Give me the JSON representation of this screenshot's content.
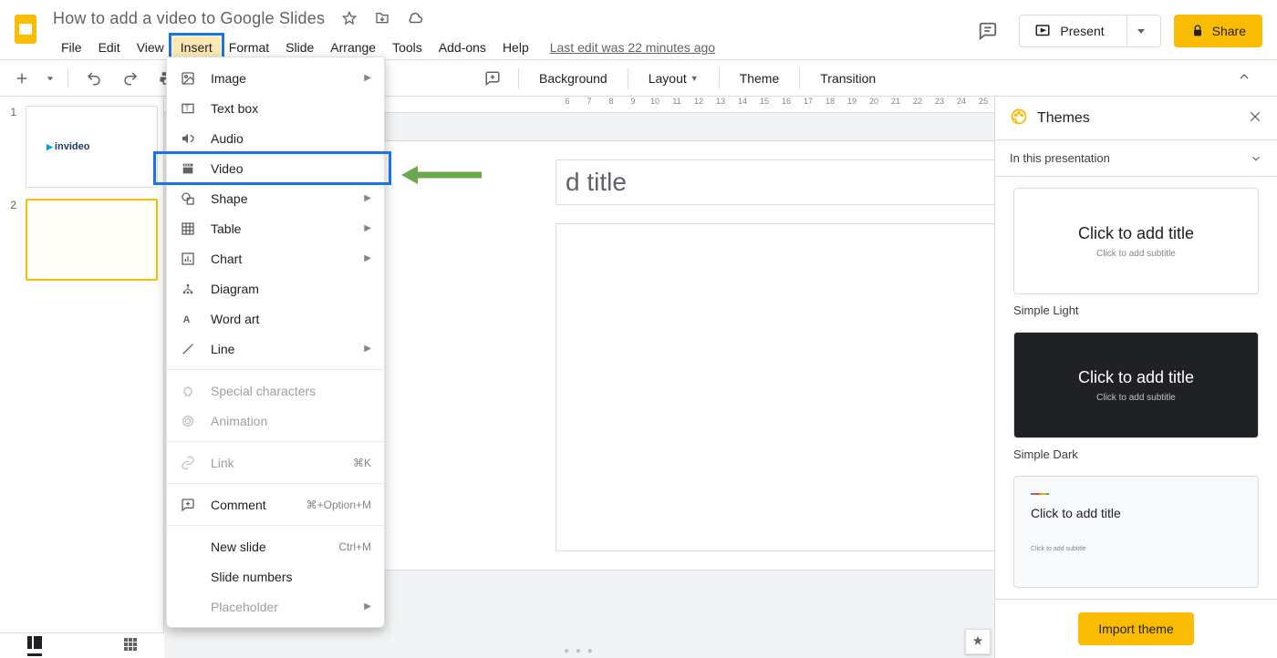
{
  "doc_title": "How to add a video to Google Slides",
  "menubar": [
    "File",
    "Edit",
    "View",
    "Insert",
    "Format",
    "Slide",
    "Arrange",
    "Tools",
    "Add-ons",
    "Help"
  ],
  "last_edit": "Last edit was 22 minutes ago",
  "header_buttons": {
    "present": "Present",
    "share": "Share"
  },
  "toolbar": {
    "background": "Background",
    "layout": "Layout",
    "theme": "Theme",
    "transition": "Transition"
  },
  "ruler_ticks": [
    "6",
    "7",
    "8",
    "9",
    "10",
    "11",
    "12",
    "13",
    "14",
    "15",
    "16",
    "17",
    "18",
    "19",
    "20",
    "21",
    "22",
    "23",
    "24",
    "25"
  ],
  "slides": {
    "s1": "1",
    "s2": "2",
    "brand": "invideo"
  },
  "canvas": {
    "title_ph": "d title"
  },
  "themes_panel": {
    "title": "Themes",
    "subtitle": "In this presentation",
    "card_title": "Click to add title",
    "card_sub": "Click to add subtitle",
    "labels": {
      "light": "Simple Light",
      "dark": "Simple Dark"
    },
    "import": "Import theme"
  },
  "insert_menu": [
    {
      "label": "Image",
      "icon": "image",
      "arrow": true
    },
    {
      "label": "Text box",
      "icon": "textbox"
    },
    {
      "label": "Audio",
      "icon": "audio"
    },
    {
      "label": "Video",
      "icon": "video",
      "highlight": true
    },
    {
      "label": "Shape",
      "icon": "shape",
      "arrow": true
    },
    {
      "label": "Table",
      "icon": "table",
      "arrow": true
    },
    {
      "label": "Chart",
      "icon": "chart",
      "arrow": true
    },
    {
      "label": "Diagram",
      "icon": "diagram"
    },
    {
      "label": "Word art",
      "icon": "wordart"
    },
    {
      "label": "Line",
      "icon": "line",
      "arrow": true
    },
    {
      "sep": true
    },
    {
      "label": "Special characters",
      "icon": "omega",
      "disabled": true
    },
    {
      "label": "Animation",
      "icon": "anim",
      "disabled": true
    },
    {
      "sep": true
    },
    {
      "label": "Link",
      "icon": "link",
      "disabled": true,
      "shortcut": "⌘K"
    },
    {
      "sep": true
    },
    {
      "label": "Comment",
      "icon": "comment",
      "shortcut": "⌘+Option+M"
    },
    {
      "sep": true
    },
    {
      "label": "New slide",
      "shortcut": "Ctrl+M"
    },
    {
      "label": "Slide numbers"
    },
    {
      "label": "Placeholder",
      "disabled": true,
      "arrow": true
    }
  ]
}
